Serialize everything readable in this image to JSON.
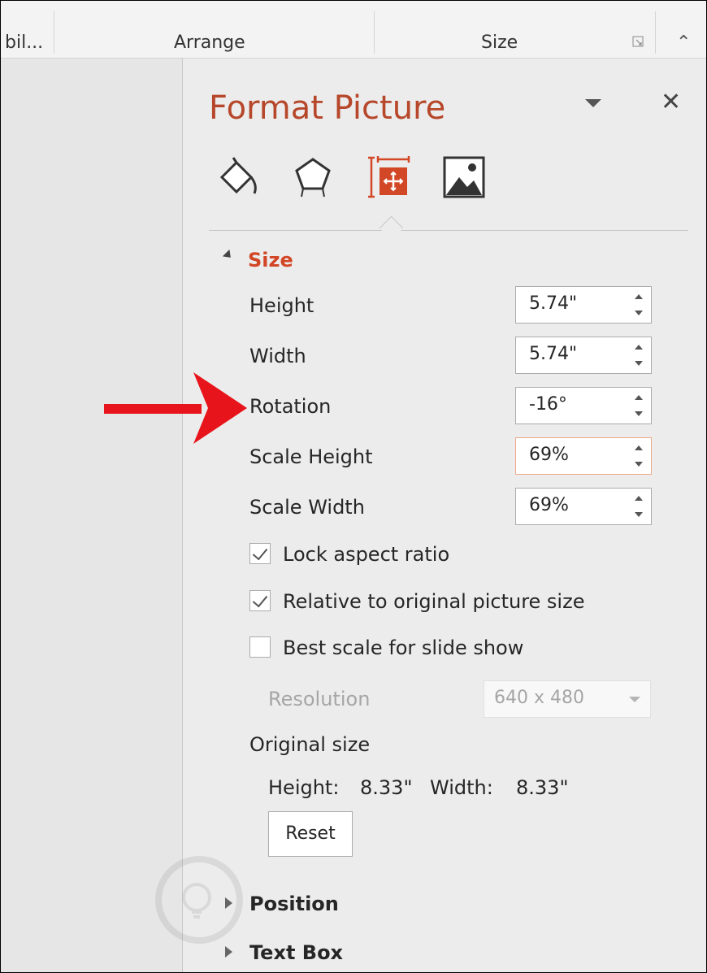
{
  "ribbon": {
    "group_left": "bil...",
    "group_arrange": "Arrange",
    "group_size": "Size"
  },
  "pane": {
    "title": "Format Picture",
    "tabs": [
      {
        "name": "fill-line-icon"
      },
      {
        "name": "effects-icon"
      },
      {
        "name": "size-properties-icon"
      },
      {
        "name": "picture-icon"
      }
    ]
  },
  "size": {
    "header": "Size",
    "height_label": "Height",
    "height_value": "5.74\"",
    "width_label": "Width",
    "width_value": "5.74\"",
    "rotation_label": "Rotation",
    "rotation_value": "-16°",
    "scale_height_label": "Scale Height",
    "scale_height_value": "69%",
    "scale_width_label": "Scale Width",
    "scale_width_value": "69%",
    "lock_aspect_label": "Lock aspect ratio",
    "lock_aspect_checked": true,
    "relative_label": "Relative to original picture size",
    "relative_checked": true,
    "best_scale_label": "Best scale for slide show",
    "best_scale_checked": false,
    "resolution_label": "Resolution",
    "resolution_value": "640 x 480",
    "original_size_label": "Original size",
    "orig_height_label": "Height:",
    "orig_height_value": "8.33\"",
    "orig_width_label": "Width:",
    "orig_width_value": "8.33\"",
    "reset_label": "Reset"
  },
  "sections": {
    "position": "Position",
    "text_box": "Text Box"
  },
  "colors": {
    "accent": "#b7472a",
    "annotation_arrow": "#e8141b"
  }
}
